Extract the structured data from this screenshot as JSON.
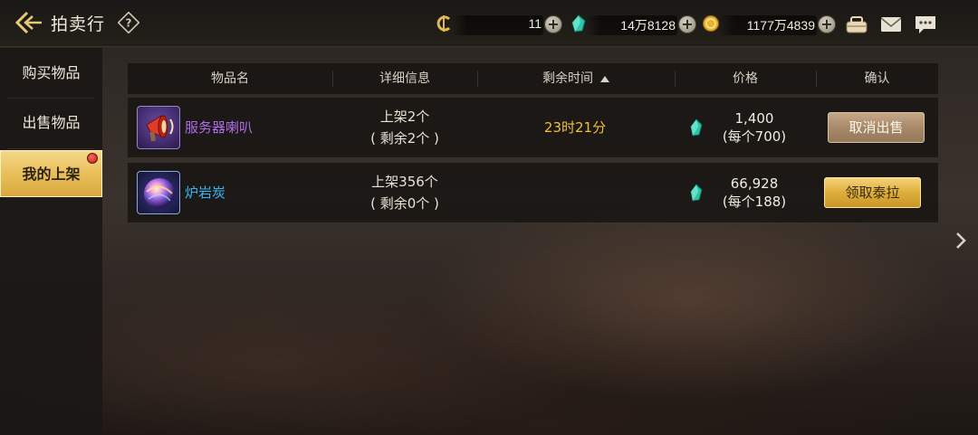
{
  "header": {
    "title": "拍卖行",
    "currencies": [
      {
        "name": "coin",
        "icon": "c-coin-icon",
        "value": "11"
      },
      {
        "name": "gem",
        "icon": "green-gem-icon",
        "value": "14万8128"
      },
      {
        "name": "gold",
        "icon": "gold-coin-icon",
        "value": "1177万4839"
      }
    ]
  },
  "sidebar": {
    "items": [
      {
        "label": "购买物品",
        "active": false
      },
      {
        "label": "出售物品",
        "active": false
      },
      {
        "label": "我的上架",
        "active": true
      }
    ]
  },
  "table": {
    "columns": [
      "物品名",
      "详细信息",
      "剩余时间",
      "价格",
      "确认"
    ],
    "sorted_column": "剩余时间",
    "rows": [
      {
        "name": "服务器喇叭",
        "name_color": "#b06ce8",
        "icon": "red-megaphone-icon",
        "detail_line1": "上架2个",
        "detail_line2": "( 剩余2个 )",
        "time": "23时21分",
        "price": "1,400",
        "unit_price": "(每个700)",
        "action": "取消出售"
      },
      {
        "name": "炉岩炭",
        "name_color": "#3ab4f0",
        "icon": "glowing-orb-icon",
        "detail_line1": "上架356个",
        "detail_line2": "( 剩余0个 )",
        "time": "",
        "price": "66,928",
        "unit_price": "(每个188)",
        "action": "领取泰拉"
      }
    ]
  },
  "colors": {
    "accent_gold": "#e9bf5a",
    "time_text": "#f0c030",
    "cancel_button": "#a88a6a",
    "collect_button": "#deae3a"
  }
}
